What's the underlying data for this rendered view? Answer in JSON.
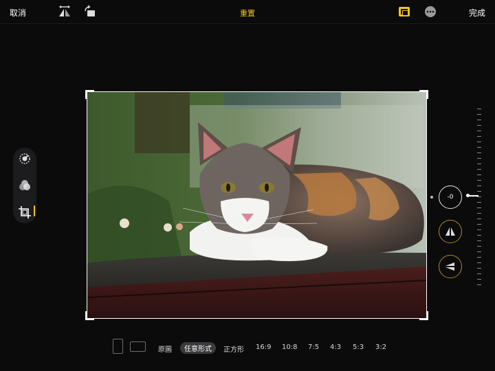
{
  "topbar": {
    "cancel_label": "取消",
    "reset_label": "重置",
    "done_label": "完成"
  },
  "straighten": {
    "value_label": "-0"
  },
  "aspect_ratios": {
    "original": "原圖",
    "freeform": "任意形式",
    "square": "正方形",
    "r16_9": "16:9",
    "r10_8": "10:8",
    "r7_5": "7:5",
    "r4_3": "4:3",
    "r5_3": "5:3",
    "r3_2": "3:2",
    "selected": "任意形式"
  },
  "colors": {
    "accent": "#f5c518",
    "background": "#0b0b0c"
  },
  "photo": {
    "subject": "calico kitten lying on brick ledge"
  }
}
